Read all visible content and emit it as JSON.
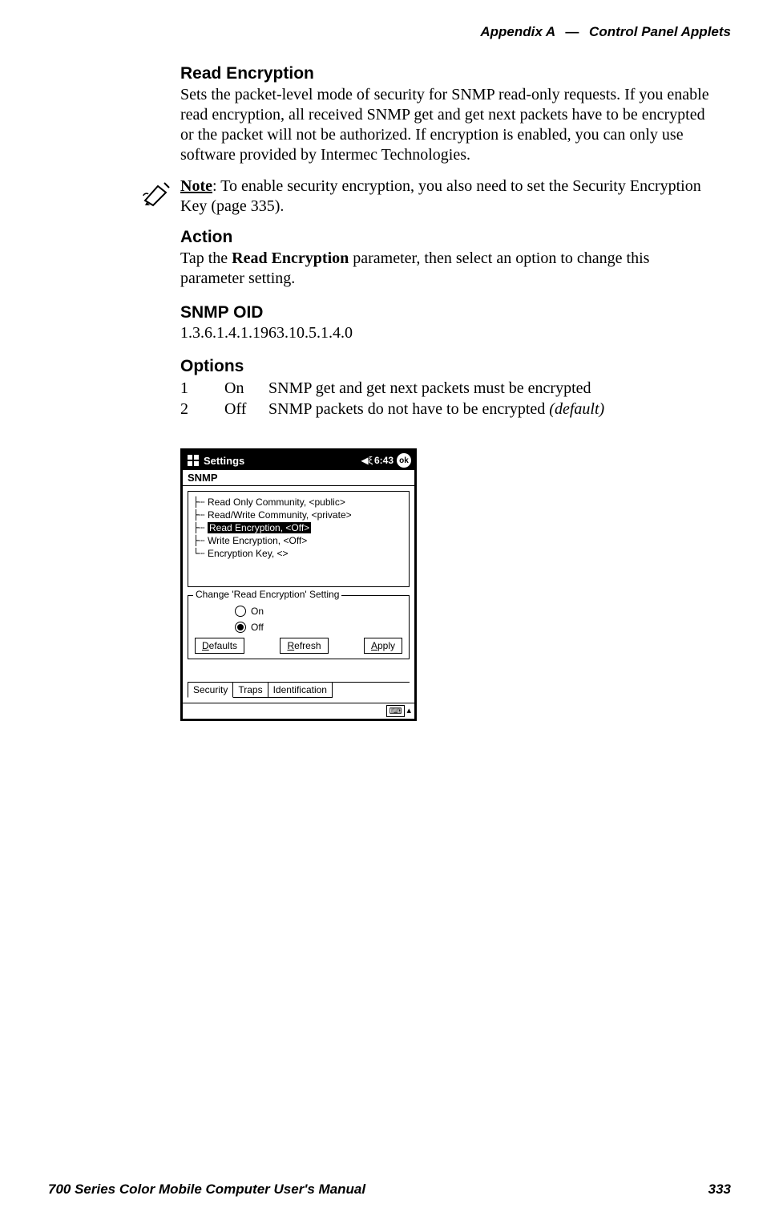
{
  "header": {
    "appendix": "Appendix A",
    "dash": "—",
    "section": "Control Panel Applets"
  },
  "readEncryption": {
    "title": "Read Encryption",
    "body": "Sets the packet-level mode of security for SNMP read-only requests. If you enable read encryption, all received SNMP get and get next packets have to be encrypted or the packet will not be authorized. If encryption is enabled, you can only use software provided by Intermec Technologies."
  },
  "note": {
    "label": "Note",
    "sep": ": ",
    "body": "To enable security encryption, you also need to set the Security Encryption Key (page 335)."
  },
  "action": {
    "title": "Action",
    "pre": "Tap the ",
    "param": "Read Encryption",
    "post": " parameter, then select an option to change this parameter setting."
  },
  "snmpOid": {
    "title": "SNMP OID",
    "value": "1.3.6.1.4.1.1963.10.5.1.4.0"
  },
  "options": {
    "title": "Options",
    "rows": [
      {
        "n": "1",
        "v": "On",
        "d": "SNMP get and get next packets must be encrypted",
        "default": ""
      },
      {
        "n": "2",
        "v": "Off",
        "d": "SNMP packets do not have to be encrypted ",
        "default": "(default)"
      }
    ]
  },
  "shot": {
    "titlebar": {
      "title": "Settings",
      "time": "6:43",
      "ok": "ok"
    },
    "appTitle": "SNMP",
    "tree": [
      {
        "t": "Read Only Community, <public>",
        "sel": false
      },
      {
        "t": "Read/Write Community, <private>",
        "sel": false
      },
      {
        "t": "Read Encryption, <Off>",
        "sel": true
      },
      {
        "t": "Write Encryption, <Off>",
        "sel": false
      },
      {
        "t": "Encryption Key, <>",
        "sel": false
      }
    ],
    "group": {
      "legend": "Change 'Read Encryption' Setting",
      "on": "On",
      "off": "Off"
    },
    "buttons": {
      "defaults": "efaults",
      "refresh": "efresh",
      "apply": "pply"
    },
    "buttonsUL": {
      "defaults": "D",
      "refresh": "R",
      "apply": "A"
    },
    "tabs": [
      "Security",
      "Traps",
      "Identification"
    ],
    "kbd": "⌨"
  },
  "footer": {
    "title": "700 Series Color Mobile Computer User's Manual",
    "page": "333"
  }
}
